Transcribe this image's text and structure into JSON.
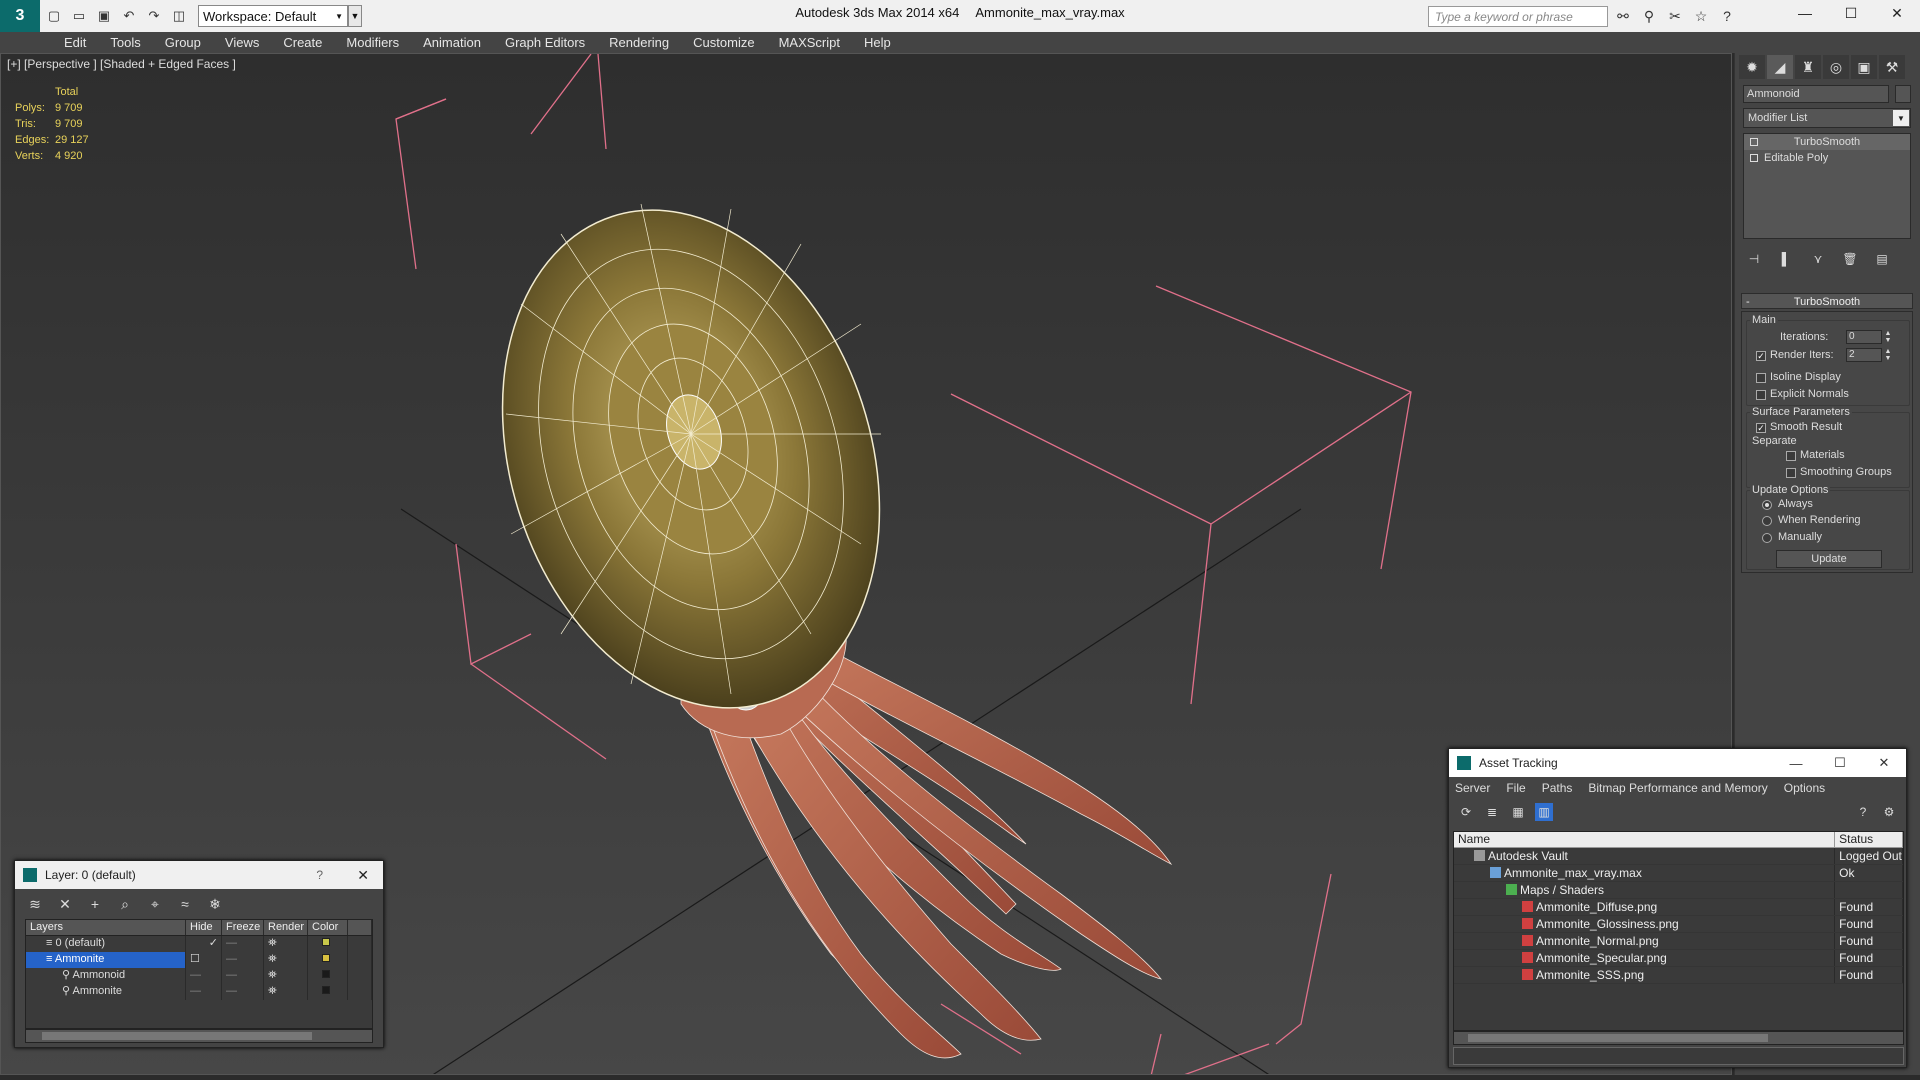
{
  "titlebar": {
    "workspace_label": "Workspace: Default",
    "app_title": "Autodesk 3ds Max  2014 x64",
    "file_name": "Ammonite_max_vray.max",
    "search_placeholder": "Type a keyword or phrase"
  },
  "menu": [
    "Edit",
    "Tools",
    "Group",
    "Views",
    "Create",
    "Modifiers",
    "Animation",
    "Graph Editors",
    "Rendering",
    "Customize",
    "MAXScript",
    "Help"
  ],
  "viewport": {
    "label": "[+] [Perspective ] [Shaded + Edged Faces ]",
    "stats": {
      "header": "Total",
      "rows": [
        {
          "k": "Polys:",
          "v": "9 709"
        },
        {
          "k": "Tris:",
          "v": "9 709"
        },
        {
          "k": "Edges:",
          "v": "29 127"
        },
        {
          "k": "Verts:",
          "v": "4 920"
        }
      ]
    }
  },
  "command_panel": {
    "object_name": "Ammonoid",
    "modifier_list": "Modifier List",
    "stack": [
      "TurboSmooth",
      "Editable Poly"
    ],
    "rollout_title": "TurboSmooth",
    "main_label": "Main",
    "iterations_label": "Iterations:",
    "iterations_value": "0",
    "render_iters_label": "Render Iters:",
    "render_iters_value": "2",
    "isoline_label": "Isoline Display",
    "explicit_normals_label": "Explicit Normals",
    "surface_params_label": "Surface Parameters",
    "smooth_result_label": "Smooth Result",
    "separate_label": "Separate",
    "materials_label": "Materials",
    "smoothing_groups_label": "Smoothing Groups",
    "update_options_label": "Update Options",
    "always_label": "Always",
    "when_rendering_label": "When Rendering",
    "manually_label": "Manually",
    "update_button": "Update"
  },
  "layer_dialog": {
    "title": "Layer: 0 (default)",
    "help": "?",
    "columns": [
      "Layers",
      "Hide",
      "Freeze",
      "Render",
      "Color"
    ],
    "rows": [
      {
        "name": "0 (default)",
        "color": "#c8c84a"
      },
      {
        "name": "Ammonite",
        "color": "#d8c040"
      },
      {
        "name": "Ammonoid",
        "color": "#1a1a1a"
      },
      {
        "name": "Ammonite",
        "color": "#1a1a1a"
      }
    ]
  },
  "asset_dialog": {
    "title": "Asset Tracking",
    "menu": [
      "Server",
      "File",
      "Paths",
      "Bitmap Performance and Memory",
      "Options"
    ],
    "columns": [
      "Name",
      "Status"
    ],
    "rows": [
      {
        "name": "Autodesk Vault",
        "status": "Logged Out"
      },
      {
        "name": "Ammonite_max_vray.max",
        "status": "Ok"
      },
      {
        "name": "Maps / Shaders",
        "status": ""
      },
      {
        "name": "Ammonite_Diffuse.png",
        "status": "Found"
      },
      {
        "name": "Ammonite_Glossiness.png",
        "status": "Found"
      },
      {
        "name": "Ammonite_Normal.png",
        "status": "Found"
      },
      {
        "name": "Ammonite_Specular.png",
        "status": "Found"
      },
      {
        "name": "Ammonite_SSS.png",
        "status": "Found"
      }
    ]
  },
  "colors": {
    "accent": "#2563c9",
    "stats": "#e8d25a",
    "bbox": "#e0708a",
    "shell": "#8a7a3a",
    "tentacle": "#b8604a"
  }
}
